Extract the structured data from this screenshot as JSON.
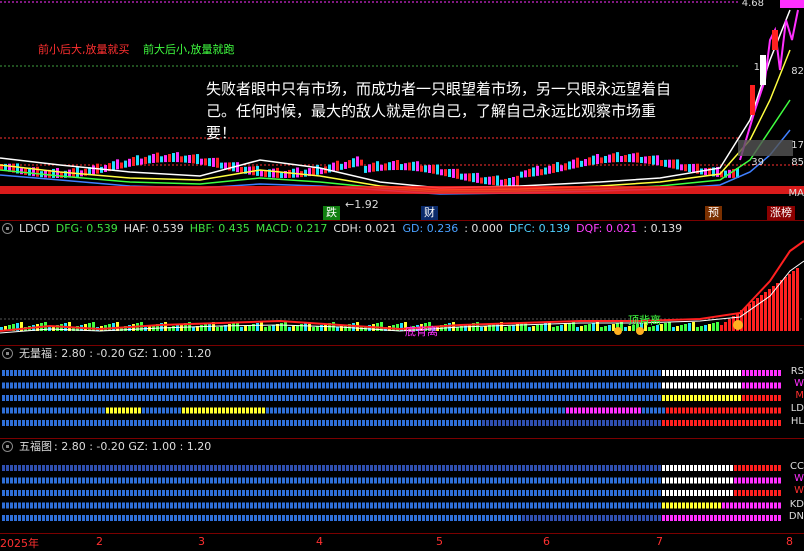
{
  "main_panel": {
    "legend_red": "前小后大,放量就买",
    "legend_green": "前大后小,放量就跑",
    "quote": "失败者眼中只有市场，而成功者一只眼望着市场，另一只眼永远望着自己。任何时候，最大的敌人就是你自己，了解自己永远比观察市场重要！",
    "low_marker": "←1.92",
    "events": [
      "跌",
      "财",
      "预",
      "涨榜"
    ],
    "price_labels": [
      "4.68",
      "KD",
      "1",
      "82",
      "17",
      "39",
      "85",
      "MA"
    ]
  },
  "ldcd_panel": {
    "name": "LDCD",
    "fields": [
      {
        "label": "DFG: 0.539",
        "color": "#40e040"
      },
      {
        "label": "HAF: 0.539",
        "color": "#e0e0e0"
      },
      {
        "label": "HBF: 0.435",
        "color": "#40e040"
      },
      {
        "label": "MACD: 0.217",
        "color": "#40e040"
      },
      {
        "label": "CDH: 0.021",
        "color": "#e0e0e0"
      },
      {
        "label": "GD: 0.236",
        "color": "#4aa0ff"
      },
      {
        "label": ": 0.000",
        "color": "#e0e0e0"
      },
      {
        "label": "DFC: 0.139",
        "color": "#4fd0ff"
      },
      {
        "label": "DQF: 0.021",
        "color": "#ff40ff"
      },
      {
        "label": ": 0.139",
        "color": "#e0e0e0"
      }
    ],
    "annotations": [
      "底背离",
      "顶背离"
    ]
  },
  "wuliangfu_panel": {
    "name": "无量福",
    "values": ": 2.80 : -0.20 GZ: 1.00 : 1.20",
    "row_labels": [
      "RS",
      "W",
      "M",
      "LD",
      "HL"
    ]
  },
  "wufutu_panel": {
    "name": "五福图",
    "values": ": 2.80 : -0.20 GZ: 1.00 : 1.20",
    "row_labels": [
      "CC",
      "W",
      "W",
      "KD",
      "DN"
    ]
  },
  "time_axis": [
    "2025年",
    "2",
    "3",
    "4",
    "5",
    "6",
    "7",
    "8"
  ],
  "colors": {
    "up": "#ff2020",
    "down": "#20e0ff",
    "separator": "#7a0000",
    "magenta": "#ff30ff",
    "blue": "#2f6fd8",
    "yellow": "#ffff30"
  }
}
